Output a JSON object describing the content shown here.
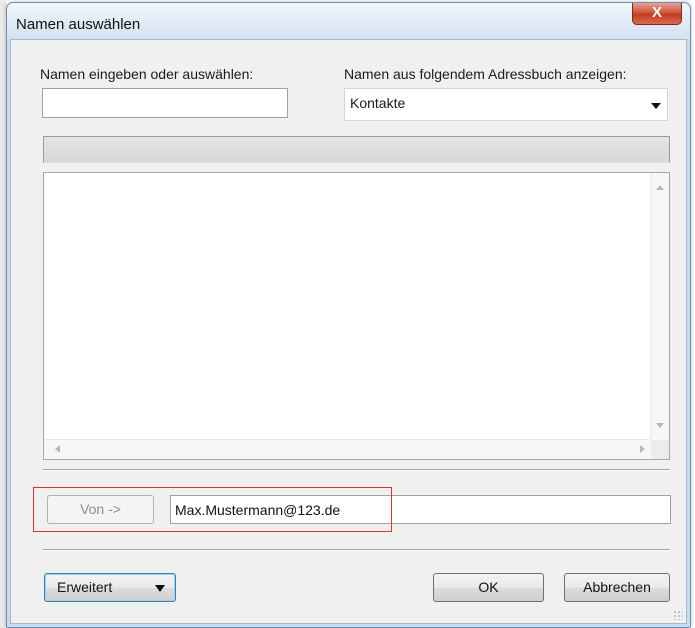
{
  "window": {
    "title": "Namen auswählen",
    "close_glyph": "X"
  },
  "search": {
    "label": "Namen eingeben oder auswählen:",
    "value": ""
  },
  "addressbook": {
    "label": "Namen aus folgendem Adressbuch anzeigen:",
    "selected": "Kontakte"
  },
  "from_field": {
    "button_label": "Von ->",
    "value": "Max.Mustermann@123.de"
  },
  "buttons": {
    "advanced": "Erweitert",
    "ok": "OK",
    "cancel": "Abbrechen"
  },
  "icons": {
    "close": "close-icon",
    "dropdown": "chevron-down-icon",
    "resize": "resize-grip-icon"
  },
  "colors": {
    "highlight": "#e0302c",
    "default_button_border": "#3c7fb1"
  }
}
